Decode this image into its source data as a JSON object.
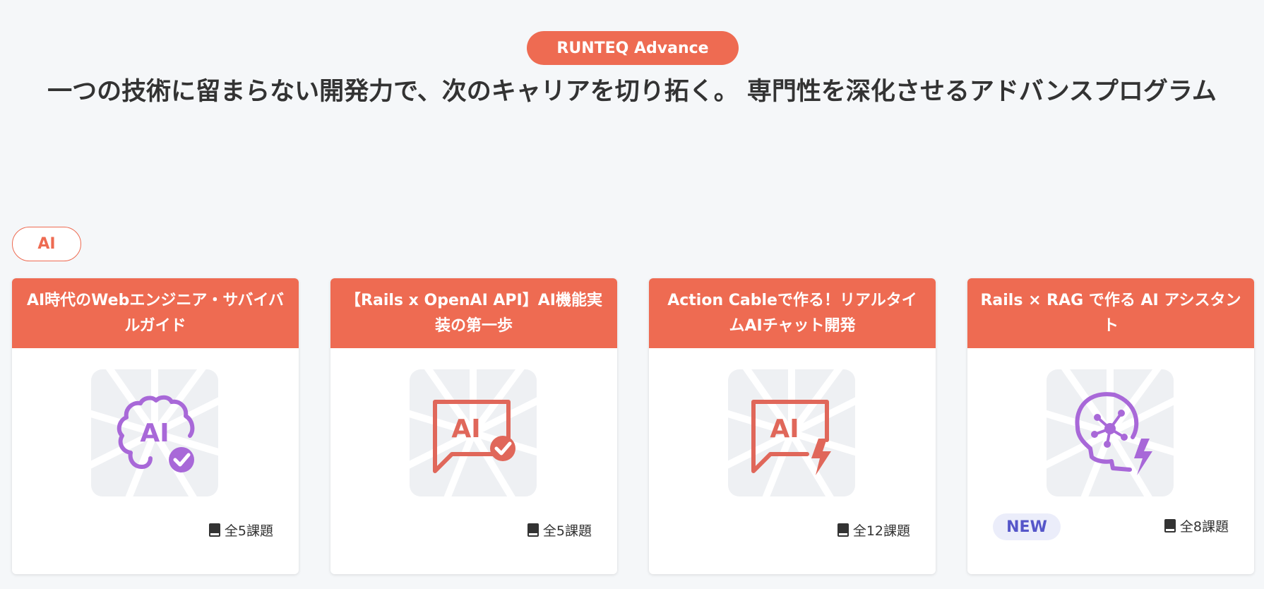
{
  "hero": {
    "badge": "RUNTEQ Advance",
    "title": "一つの技術に留まらない開発力で、次のキャリアを切り拓く。 専門性を深化させるアドバンスプログラム"
  },
  "category": {
    "label": "AI"
  },
  "colors": {
    "accent": "#ee6b52",
    "purple": "#a868d8",
    "red": "#e0675a",
    "new_bg": "#ebedfa",
    "new_text": "#5556c9"
  },
  "cards": [
    {
      "title": "AI時代のWebエンジニア・サバイバルガイド",
      "icon": "ai-brain-check-icon",
      "count": "全5課題"
    },
    {
      "title": "【Rails x OpenAI API】AI機能実装の第一歩",
      "icon": "ai-chat-check-icon",
      "count": "全5課題"
    },
    {
      "title": "Action Cableで作る！リアルタイムAIチャット開発",
      "icon": "ai-chat-bolt-icon",
      "count": "全12課題"
    },
    {
      "title": "Rails × RAG で作る AI アシスタント",
      "icon": "ai-head-network-bolt-icon",
      "count": "全8課題",
      "badge": "NEW"
    }
  ]
}
